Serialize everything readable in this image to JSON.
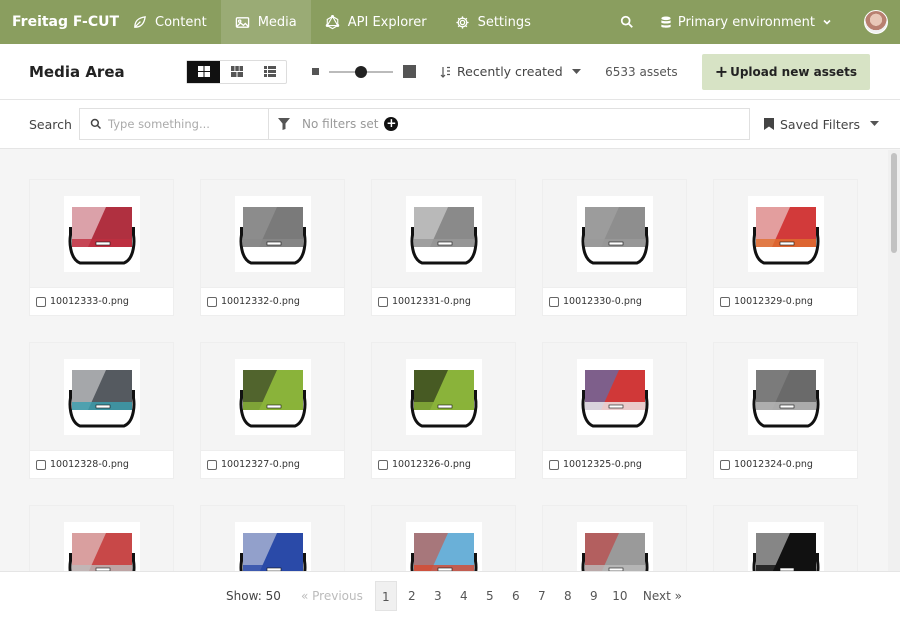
{
  "nav": {
    "brand": "Freitag F-CUT",
    "items": [
      {
        "label": "Content",
        "icon": "leaf-icon",
        "active": false
      },
      {
        "label": "Media",
        "icon": "image-icon",
        "active": true
      },
      {
        "label": "API Explorer",
        "icon": "graphql-icon",
        "active": false
      },
      {
        "label": "Settings",
        "icon": "gear-icon",
        "active": false
      }
    ],
    "environment": "Primary environment"
  },
  "toolbar": {
    "title": "Media Area",
    "sort_label": "Recently created",
    "asset_count": "6533 assets",
    "upload_label": "Upload new assets",
    "thumb_size_level": 0.5
  },
  "search": {
    "label": "Search",
    "placeholder": "Type something...",
    "filters_text": "No filters set",
    "saved_filters": "Saved Filters"
  },
  "assets": [
    {
      "filename": "10012333-0.png",
      "flap": "#b03040",
      "accent": "#ffffff",
      "strip": "#c03040"
    },
    {
      "filename": "10012332-0.png",
      "flap": "#7a7a7a",
      "accent": "#9a9a9a",
      "strip": "#888888"
    },
    {
      "filename": "10012331-0.png",
      "flap": "#8a8a8a",
      "accent": "#e0e0e0",
      "strip": "#999999"
    },
    {
      "filename": "10012330-0.png",
      "flap": "#8e8e8e",
      "accent": "#a8a8a8",
      "strip": "#9a9a9a"
    },
    {
      "filename": "10012329-0.png",
      "flap": "#d23a3a",
      "accent": "#f0f0f0",
      "strip": "#e07030"
    },
    {
      "filename": "10012328-0.png",
      "flap": "#555a60",
      "accent": "#e8e8e8",
      "strip": "#3aa0b0"
    },
    {
      "filename": "10012327-0.png",
      "flap": "#8ab33a",
      "accent": "#222222",
      "strip": "#8ab33a"
    },
    {
      "filename": "10012326-0.png",
      "flap": "#8ab33a",
      "accent": "#111111",
      "strip": "#8ab33a"
    },
    {
      "filename": "10012325-0.png",
      "flap": "#d03838",
      "accent": "#3a7fd0",
      "strip": "#f0f0f0"
    },
    {
      "filename": "10012324-0.png",
      "flap": "#6a6a6a",
      "accent": "#888888",
      "strip": "#bbbbbb"
    },
    {
      "filename": "",
      "flap": "#c84848",
      "accent": "#e8e8e8",
      "strip": "#bbbbbb"
    },
    {
      "filename": "",
      "flap": "#2a4aa8",
      "accent": "#e8e8e8",
      "strip": "#2a4aa8"
    },
    {
      "filename": "",
      "flap": "#6ab0d8",
      "accent": "#d84830",
      "strip": "#d84830"
    },
    {
      "filename": "",
      "flap": "#9a9a9a",
      "accent": "#c83030",
      "strip": "#bbbbbb"
    },
    {
      "filename": "",
      "flap": "#111111",
      "accent": "#e8e8e8",
      "strip": "#111111"
    }
  ],
  "pagination": {
    "show_label": "Show: 50",
    "prev": "« Previous",
    "pages": [
      "1",
      "2",
      "3",
      "4",
      "5",
      "6",
      "7",
      "8",
      "9",
      "10"
    ],
    "current": "1",
    "next": "Next »"
  }
}
